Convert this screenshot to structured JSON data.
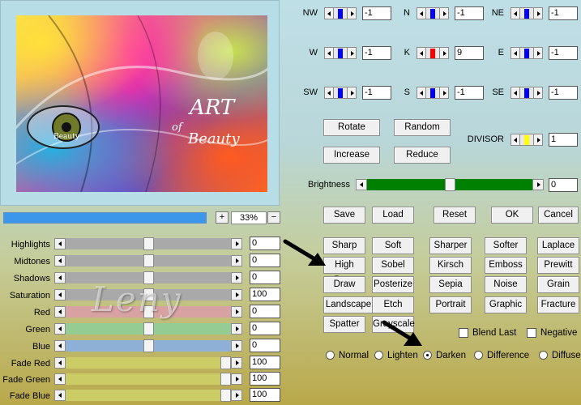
{
  "preview": {
    "zoom": "33%",
    "progress_percent": 100
  },
  "sliders": [
    {
      "label": "Highlights",
      "value": "0",
      "level": 0.5,
      "color": "#a9a9a9"
    },
    {
      "label": "Midtones",
      "value": "0",
      "level": 0.5,
      "color": "#a9a9a9"
    },
    {
      "label": "Shadows",
      "value": "0",
      "level": 0.5,
      "color": "#a9a9a9"
    },
    {
      "label": "Saturation",
      "value": "100",
      "level": 0.5,
      "color": "#a9a9a9"
    },
    {
      "label": "Red",
      "value": "0",
      "level": 0.5,
      "color": "#d8a2a2"
    },
    {
      "label": "Green",
      "value": "0",
      "level": 0.5,
      "color": "#94cc94"
    },
    {
      "label": "Blue",
      "value": "0",
      "level": 0.5,
      "color": "#8fb0d6"
    },
    {
      "label": "Fade Red",
      "value": "100",
      "level": 1.0,
      "color": "#cccc66"
    },
    {
      "label": "Fade Green",
      "value": "100",
      "level": 1.0,
      "color": "#cccc66"
    },
    {
      "label": "Fade Blue",
      "value": "100",
      "level": 1.0,
      "color": "#cccc66"
    }
  ],
  "matrix": [
    {
      "label": "NW",
      "value": "-1",
      "knob": "#0000ff"
    },
    {
      "label": "N",
      "value": "-1",
      "knob": "#0000ff"
    },
    {
      "label": "NE",
      "value": "-1",
      "knob": "#0000ff"
    },
    {
      "label": "W",
      "value": "-1",
      "knob": "#0000ff"
    },
    {
      "label": "K",
      "value": "9",
      "knob": "#ff0000"
    },
    {
      "label": "E",
      "value": "-1",
      "knob": "#0000ff"
    },
    {
      "label": "SW",
      "value": "-1",
      "knob": "#0000ff"
    },
    {
      "label": "S",
      "value": "-1",
      "knob": "#0000ff"
    },
    {
      "label": "SE",
      "value": "-1",
      "knob": "#0000ff"
    }
  ],
  "buttons": {
    "rotate": "Rotate",
    "random": "Random",
    "increase": "Increase",
    "reduce": "Reduce",
    "save": "Save",
    "load": "Load",
    "reset": "Reset",
    "ok": "OK",
    "cancel": "Cancel"
  },
  "divisor": {
    "label": "DIVISOR",
    "value": "1",
    "knob": "#ffff00"
  },
  "brightness": {
    "label": "Brightness",
    "value": "0",
    "level": 0.5,
    "color": "#008000"
  },
  "presets": [
    "Sharp",
    "Soft",
    "Sharper",
    "Softer",
    "Laplace",
    "High Pass",
    "Sobel",
    "Kirsch",
    "Emboss",
    "Prewitt",
    "Draw",
    "Posterize",
    "Sepia",
    "Noise",
    "Grain",
    "Landscape",
    "Etch",
    "Portrait",
    "Graphic",
    "Fracture",
    "Spatter",
    "Grayscale"
  ],
  "options": {
    "blend_last": "Blend Last",
    "negative": "Negative"
  },
  "modes": [
    {
      "label": "Normal",
      "selected": false
    },
    {
      "label": "Lighten",
      "selected": false
    },
    {
      "label": "Darken",
      "selected": true
    },
    {
      "label": "Difference",
      "selected": false
    },
    {
      "label": "Diffuse",
      "selected": false
    }
  ],
  "preview_art": {
    "title": "ART",
    "of": "of",
    "beauty": "Beauty",
    "eye_text": "Beauty"
  },
  "watermark": "Leny"
}
